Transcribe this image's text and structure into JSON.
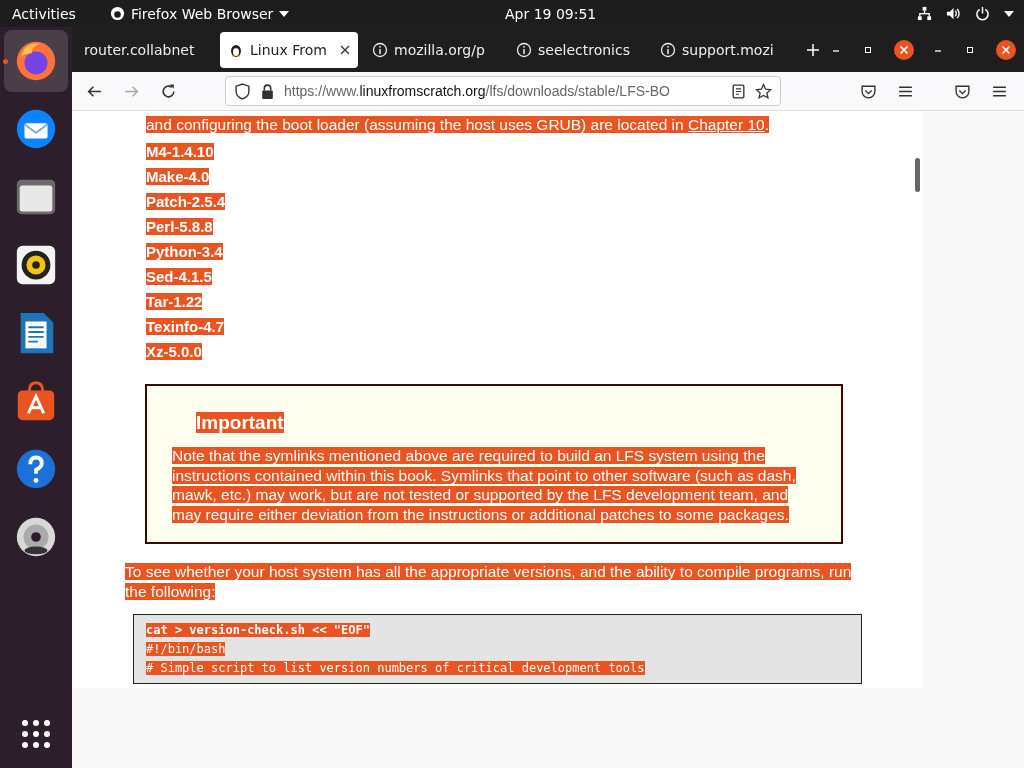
{
  "top_bar": {
    "activities": "Activities",
    "app_menu": "Firefox Web Browser",
    "clock": "Apr 19  09:51"
  },
  "dock": {
    "items": [
      {
        "kind": "firefox",
        "running": true,
        "selected": true
      },
      {
        "kind": "mail",
        "running": false,
        "selected": false
      },
      {
        "kind": "files",
        "running": false,
        "selected": false
      },
      {
        "kind": "music",
        "running": false,
        "selected": false
      },
      {
        "kind": "writer",
        "running": false,
        "selected": false
      },
      {
        "kind": "store",
        "running": false,
        "selected": false
      },
      {
        "kind": "help",
        "running": false,
        "selected": false
      },
      {
        "kind": "dvd",
        "running": false,
        "selected": false
      }
    ]
  },
  "browser": {
    "tabs": [
      {
        "label": "router.collabnet",
        "kind": "plain",
        "selected": false
      },
      {
        "label": "Linux From",
        "kind": "favicon",
        "selected": true
      },
      {
        "label": "mozilla.org/p",
        "kind": "info",
        "selected": false
      },
      {
        "label": "seelectronics",
        "kind": "info",
        "selected": false
      },
      {
        "label": "support.mozi",
        "kind": "info",
        "selected": false
      }
    ],
    "url": {
      "prefix": "https://www.",
      "domain": "linuxfromscratch.org",
      "path": "/lfs/downloads/stable/LFS-BO"
    }
  },
  "page": {
    "intro": {
      "text": "and configuring the boot loader (assuming the host uses GRUB) are located in ",
      "link": "Chapter 10",
      "end": "."
    },
    "packages": [
      "M4-1.4.10",
      "Make-4.0",
      "Patch-2.5.4",
      "Perl-5.8.8",
      "Python-3.4",
      "Sed-4.1.5",
      "Tar-1.22",
      "Texinfo-4.7",
      "Xz-5.0.0"
    ],
    "note": {
      "title": "Important",
      "text": "Note that the symlinks mentioned above are required to build an LFS system using the instructions contained within this book. Symlinks that point to other software (such as dash, mawk, etc.) may work, but are not tested or supported by the LFS development team, and may require either deviation from the instructions or additional patches to some packages."
    },
    "paragraph": "To see whether your host system has all the appropriate versions, and the ability to compile programs, run the following:",
    "code": [
      {
        "text": "cat > version-check.sh << \"EOF\"",
        "bold": true
      },
      {
        "text": "#!/bin/bash",
        "bold": false
      },
      {
        "text": "# Simple script to list version numbers of critical development tools",
        "bold": false
      }
    ]
  }
}
